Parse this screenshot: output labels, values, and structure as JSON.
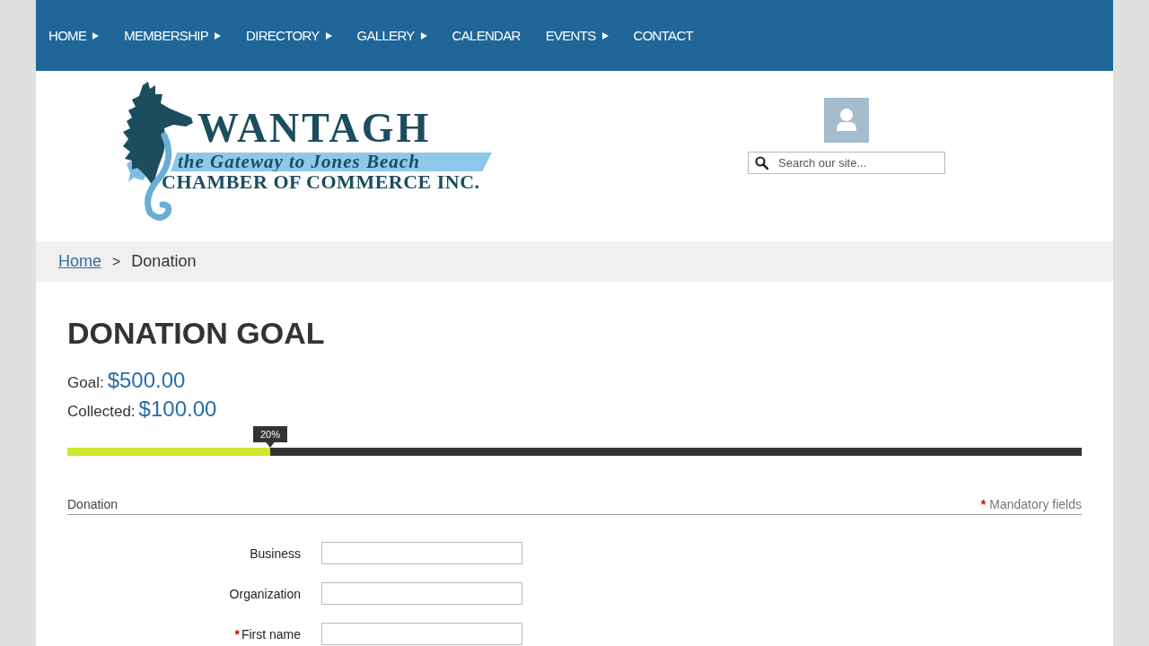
{
  "nav": {
    "items": [
      {
        "label": "HOME",
        "has_submenu": true
      },
      {
        "label": "MEMBERSHIP",
        "has_submenu": true
      },
      {
        "label": "DIRECTORY",
        "has_submenu": true
      },
      {
        "label": "GALLERY",
        "has_submenu": true
      },
      {
        "label": "CALENDAR",
        "has_submenu": false
      },
      {
        "label": "EVENTS",
        "has_submenu": true
      },
      {
        "label": "CONTACT",
        "has_submenu": false
      }
    ]
  },
  "header": {
    "logo": {
      "title": "WANTAGH",
      "tagline": "the Gateway to Jones Beach",
      "subtitle": "CHAMBER OF COMMERCE INC."
    },
    "search": {
      "placeholder": "Search our site..."
    }
  },
  "breadcrumb": [
    {
      "label": "Home",
      "kind": "link"
    },
    {
      "label": ">",
      "kind": "separator"
    },
    {
      "label": "Donation",
      "kind": "current"
    }
  ],
  "goal": {
    "title": "DONATION GOAL",
    "goal_label": "Goal:",
    "goal_value": "$500.00",
    "collected_label": "Collected:",
    "collected_value": "$100.00",
    "progress": {
      "level": 0.2,
      "reading": "20%"
    }
  },
  "form": {
    "legend": "Donation",
    "note_mark": "*",
    "note": "Mandatory fields",
    "fields": [
      {
        "label": "Business",
        "required": false
      },
      {
        "label": "Organization",
        "required": false
      },
      {
        "label": "First name",
        "required": true,
        "required_mark": "*"
      }
    ]
  }
}
